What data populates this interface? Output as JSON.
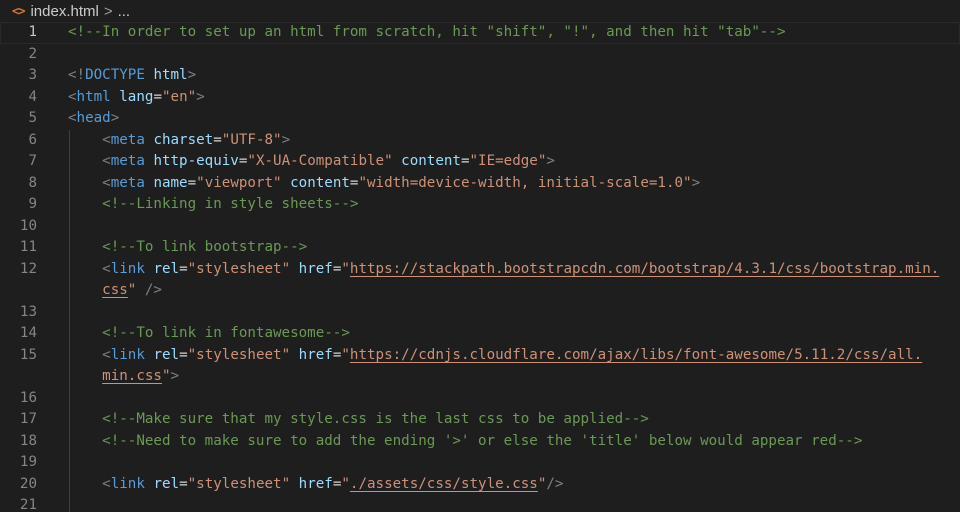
{
  "breadcrumb": {
    "icon": "html-file-icon",
    "file": "index.html",
    "separator": ">",
    "more": "..."
  },
  "colors": {
    "background": "#1e1e1e",
    "comment": "#6a9955",
    "tag": "#569cd6",
    "attribute": "#9cdcfe",
    "string": "#ce9178",
    "punctuation": "#808080",
    "line_number": "#858585"
  },
  "editor": {
    "active_line": 1,
    "lines": [
      {
        "n": "1",
        "indent": 0,
        "tokens": [
          {
            "c": "comment",
            "t": "<!--In order to set up an html from scratch, hit \"shift\", \"!\", and then hit \"tab\"-->"
          }
        ]
      },
      {
        "n": "2",
        "indent": 0,
        "tokens": []
      },
      {
        "n": "3",
        "indent": 0,
        "tokens": [
          {
            "c": "bracket",
            "t": "<!"
          },
          {
            "c": "tag",
            "t": "DOCTYPE"
          },
          {
            "c": "text",
            "t": " "
          },
          {
            "c": "attr",
            "t": "html"
          },
          {
            "c": "bracket",
            "t": ">"
          }
        ]
      },
      {
        "n": "4",
        "indent": 0,
        "tokens": [
          {
            "c": "bracket",
            "t": "<"
          },
          {
            "c": "tag",
            "t": "html"
          },
          {
            "c": "text",
            "t": " "
          },
          {
            "c": "attr",
            "t": "lang"
          },
          {
            "c": "eq",
            "t": "="
          },
          {
            "c": "str",
            "t": "\"en\""
          },
          {
            "c": "bracket",
            "t": ">"
          }
        ]
      },
      {
        "n": "5",
        "indent": 0,
        "tokens": [
          {
            "c": "bracket",
            "t": "<"
          },
          {
            "c": "tag",
            "t": "head"
          },
          {
            "c": "bracket",
            "t": ">"
          }
        ]
      },
      {
        "n": "6",
        "indent": 1,
        "tokens": [
          {
            "c": "bracket",
            "t": "<"
          },
          {
            "c": "tag",
            "t": "meta"
          },
          {
            "c": "text",
            "t": " "
          },
          {
            "c": "attr",
            "t": "charset"
          },
          {
            "c": "eq",
            "t": "="
          },
          {
            "c": "str",
            "t": "\"UTF-8\""
          },
          {
            "c": "bracket",
            "t": ">"
          }
        ]
      },
      {
        "n": "7",
        "indent": 1,
        "tokens": [
          {
            "c": "bracket",
            "t": "<"
          },
          {
            "c": "tag",
            "t": "meta"
          },
          {
            "c": "text",
            "t": " "
          },
          {
            "c": "attr",
            "t": "http-equiv"
          },
          {
            "c": "eq",
            "t": "="
          },
          {
            "c": "str",
            "t": "\"X-UA-Compatible\""
          },
          {
            "c": "text",
            "t": " "
          },
          {
            "c": "attr",
            "t": "content"
          },
          {
            "c": "eq",
            "t": "="
          },
          {
            "c": "str",
            "t": "\"IE=edge\""
          },
          {
            "c": "bracket",
            "t": ">"
          }
        ]
      },
      {
        "n": "8",
        "indent": 1,
        "tokens": [
          {
            "c": "bracket",
            "t": "<"
          },
          {
            "c": "tag",
            "t": "meta"
          },
          {
            "c": "text",
            "t": " "
          },
          {
            "c": "attr",
            "t": "name"
          },
          {
            "c": "eq",
            "t": "="
          },
          {
            "c": "str",
            "t": "\"viewport\""
          },
          {
            "c": "text",
            "t": " "
          },
          {
            "c": "attr",
            "t": "content"
          },
          {
            "c": "eq",
            "t": "="
          },
          {
            "c": "str",
            "t": "\"width=device-width, initial-scale=1.0\""
          },
          {
            "c": "bracket",
            "t": ">"
          }
        ]
      },
      {
        "n": "9",
        "indent": 1,
        "tokens": [
          {
            "c": "comment",
            "t": "<!--Linking in style sheets-->"
          }
        ]
      },
      {
        "n": "10",
        "indent": 1,
        "tokens": []
      },
      {
        "n": "11",
        "indent": 1,
        "tokens": [
          {
            "c": "comment",
            "t": "<!--To link bootstrap-->"
          }
        ]
      },
      {
        "n": "12",
        "indent": 1,
        "tokens": [
          {
            "c": "bracket",
            "t": "<"
          },
          {
            "c": "tag",
            "t": "link"
          },
          {
            "c": "text",
            "t": " "
          },
          {
            "c": "attr",
            "t": "rel"
          },
          {
            "c": "eq",
            "t": "="
          },
          {
            "c": "str",
            "t": "\"stylesheet\""
          },
          {
            "c": "text",
            "t": " "
          },
          {
            "c": "attr",
            "t": "href"
          },
          {
            "c": "eq",
            "t": "="
          },
          {
            "c": "str",
            "t": "\""
          },
          {
            "c": "link",
            "t": "https://stackpath.bootstrapcdn.com/bootstrap/4.3.1/css/bootstrap.min."
          }
        ]
      },
      {
        "n": "",
        "indent": 1,
        "tokens": [
          {
            "c": "link",
            "t": "css"
          },
          {
            "c": "str",
            "t": "\""
          },
          {
            "c": "text",
            "t": " "
          },
          {
            "c": "bracket",
            "t": "/>"
          }
        ]
      },
      {
        "n": "13",
        "indent": 1,
        "tokens": []
      },
      {
        "n": "14",
        "indent": 1,
        "tokens": [
          {
            "c": "comment",
            "t": "<!--To link in fontawesome-->"
          }
        ]
      },
      {
        "n": "15",
        "indent": 1,
        "tokens": [
          {
            "c": "bracket",
            "t": "<"
          },
          {
            "c": "tag",
            "t": "link"
          },
          {
            "c": "text",
            "t": " "
          },
          {
            "c": "attr",
            "t": "rel"
          },
          {
            "c": "eq",
            "t": "="
          },
          {
            "c": "str",
            "t": "\"stylesheet\""
          },
          {
            "c": "text",
            "t": " "
          },
          {
            "c": "attr",
            "t": "href"
          },
          {
            "c": "eq",
            "t": "="
          },
          {
            "c": "str",
            "t": "\""
          },
          {
            "c": "link",
            "t": "https://cdnjs.cloudflare.com/ajax/libs/font-awesome/5.11.2/css/all."
          }
        ]
      },
      {
        "n": "",
        "indent": 1,
        "tokens": [
          {
            "c": "link",
            "t": "min.css"
          },
          {
            "c": "str",
            "t": "\""
          },
          {
            "c": "bracket",
            "t": ">"
          }
        ]
      },
      {
        "n": "16",
        "indent": 1,
        "tokens": []
      },
      {
        "n": "17",
        "indent": 1,
        "tokens": [
          {
            "c": "comment",
            "t": "<!--Make sure that my style.css is the last css to be applied-->"
          }
        ]
      },
      {
        "n": "18",
        "indent": 1,
        "tokens": [
          {
            "c": "comment",
            "t": "<!--Need to make sure to add the ending '>' or else the 'title' below would appear red-->"
          }
        ]
      },
      {
        "n": "19",
        "indent": 1,
        "tokens": []
      },
      {
        "n": "20",
        "indent": 1,
        "tokens": [
          {
            "c": "bracket",
            "t": "<"
          },
          {
            "c": "tag",
            "t": "link"
          },
          {
            "c": "text",
            "t": " "
          },
          {
            "c": "attr",
            "t": "rel"
          },
          {
            "c": "eq",
            "t": "="
          },
          {
            "c": "str",
            "t": "\"stylesheet\""
          },
          {
            "c": "text",
            "t": " "
          },
          {
            "c": "attr",
            "t": "href"
          },
          {
            "c": "eq",
            "t": "="
          },
          {
            "c": "str",
            "t": "\""
          },
          {
            "c": "link",
            "t": "./assets/css/style.css"
          },
          {
            "c": "str",
            "t": "\""
          },
          {
            "c": "bracket",
            "t": "/>"
          }
        ]
      },
      {
        "n": "21",
        "indent": 1,
        "tokens": []
      }
    ]
  }
}
